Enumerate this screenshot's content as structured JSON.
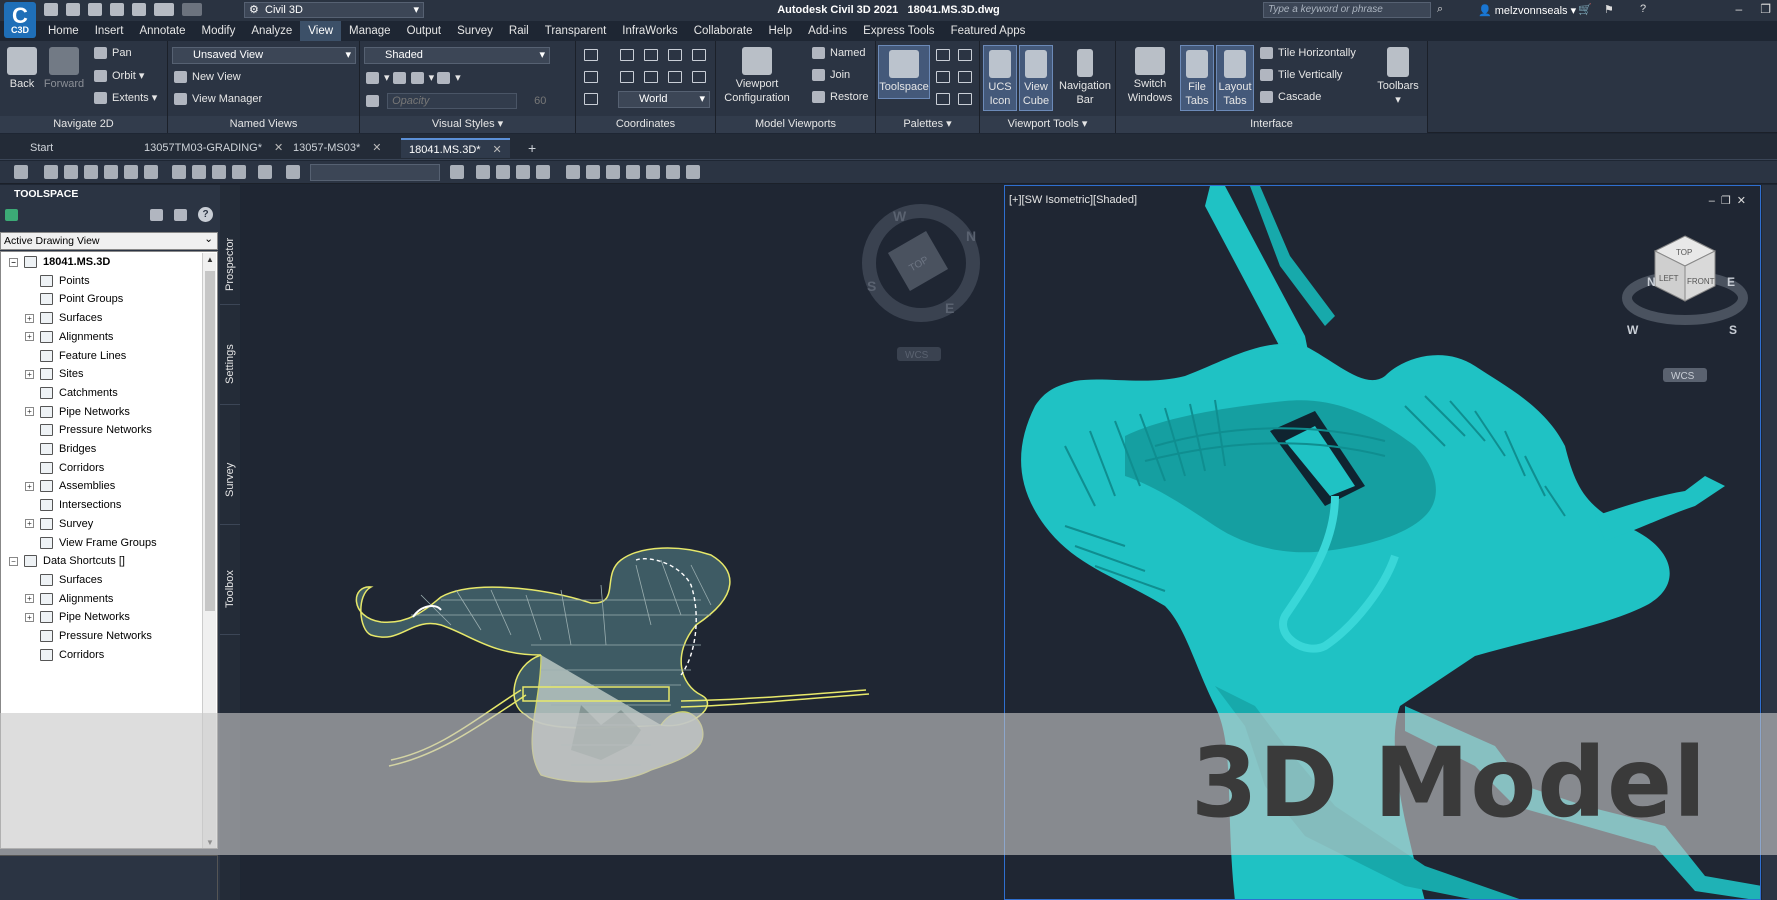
{
  "app": {
    "title": "Autodesk Civil 3D 2021",
    "file": "18041.MS.3D.dwg",
    "logo_text": "C3D",
    "workspace": "Civil 3D"
  },
  "search": {
    "placeholder": "Type a keyword or phrase"
  },
  "user": {
    "name": "melzvonnseals"
  },
  "menu": {
    "items": [
      "Home",
      "Insert",
      "Annotate",
      "Modify",
      "Analyze",
      "View",
      "Manage",
      "Output",
      "Survey",
      "Rail",
      "Transparent",
      "InfraWorks",
      "Collaborate",
      "Help",
      "Add-ins",
      "Express Tools",
      "Featured Apps"
    ],
    "active": "View"
  },
  "ribbon": {
    "navigate2d": {
      "label": "Navigate 2D",
      "back": "Back",
      "forward": "Forward",
      "pan": "Pan",
      "orbit": "Orbit",
      "extents": "Extents"
    },
    "named_views": {
      "label": "Named Views",
      "combo": "Unsaved View",
      "new_view": "New View",
      "view_manager": "View Manager"
    },
    "visual_styles": {
      "label": "Visual Styles",
      "combo": "Shaded",
      "opacity": "Opacity",
      "opacity_value": "60"
    },
    "coordinates": {
      "label": "Coordinates",
      "combo": "World"
    },
    "model_viewports": {
      "label": "Model Viewports",
      "viewport_config": "Viewport Configuration",
      "named": "Named",
      "join": "Join",
      "restore": "Restore"
    },
    "palettes": {
      "label": "Palettes",
      "toolspace": "Toolspace"
    },
    "viewport_tools": {
      "label": "Viewport Tools",
      "ucs_icon": "UCS Icon",
      "view_cube": "View Cube",
      "navigation_bar": "Navigation Bar"
    },
    "interface": {
      "label": "Interface",
      "switch_windows": "Switch Windows",
      "file_tabs": "File Tabs",
      "layout_tabs": "Layout Tabs",
      "tile_h": "Tile Horizontally",
      "tile_v": "Tile Vertically",
      "cascade": "Cascade",
      "toolbars": "Toolbars"
    }
  },
  "file_tabs": [
    {
      "label": "Start"
    },
    {
      "label": "13057TM03-GRADING*"
    },
    {
      "label": "13057-MS03*"
    },
    {
      "label": "18041.MS.3D*"
    }
  ],
  "toolspace": {
    "title": "TOOLSPACE",
    "view_select": "Active Drawing View",
    "root": "18041.MS.3D",
    "items": [
      "Points",
      "Point Groups",
      "Surfaces",
      "Alignments",
      "Feature Lines",
      "Sites",
      "Catchments",
      "Pipe Networks",
      "Pressure Networks",
      "Bridges",
      "Corridors",
      "Assemblies",
      "Intersections",
      "Survey",
      "View Frame Groups"
    ],
    "data_shortcuts": "Data Shortcuts []",
    "ds_items": [
      "Surfaces",
      "Alignments",
      "Pipe Networks",
      "Pressure Networks",
      "Corridors"
    ],
    "tabs": [
      "Prospector",
      "Settings",
      "Survey",
      "Toolbox"
    ]
  },
  "viewport_left": {
    "compass": [
      "N",
      "E",
      "S",
      "W"
    ],
    "cube_label": "TOP",
    "wcs": "WCS"
  },
  "viewport_right": {
    "label": "[+][SW Isometric][Shaded]",
    "cube_labels": [
      "TOP",
      "LEFT",
      "FRONT"
    ],
    "compass": [
      "N",
      "E",
      "S",
      "W"
    ],
    "wcs": "WCS"
  },
  "overlay": {
    "text": "3D Model"
  },
  "colors": {
    "accent": "#2f6fd0",
    "model_cyan": "#1fc2c4",
    "outline_yellow": "#e7e86a"
  }
}
